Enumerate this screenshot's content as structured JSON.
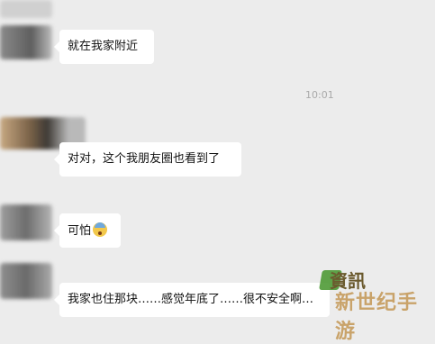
{
  "chat": {
    "timestamp": "10:01",
    "messages": [
      {
        "text": "就在我家附近"
      },
      {
        "text": "对对，这个我朋友圈也看到了"
      },
      {
        "text": "可怕"
      },
      {
        "text": "我家也住那块……感觉年底了……很不安全啊…"
      }
    ]
  },
  "watermark": {
    "line1": "資訊",
    "line2": "新世纪手游"
  },
  "icons": {
    "fearful_emoji": "fearful-face-emoji-icon",
    "watermark_logo": "watermark-logo-icon"
  },
  "colors": {
    "background": "#ececec",
    "bubble": "#ffffff",
    "timestamp": "#a9a9a9"
  }
}
